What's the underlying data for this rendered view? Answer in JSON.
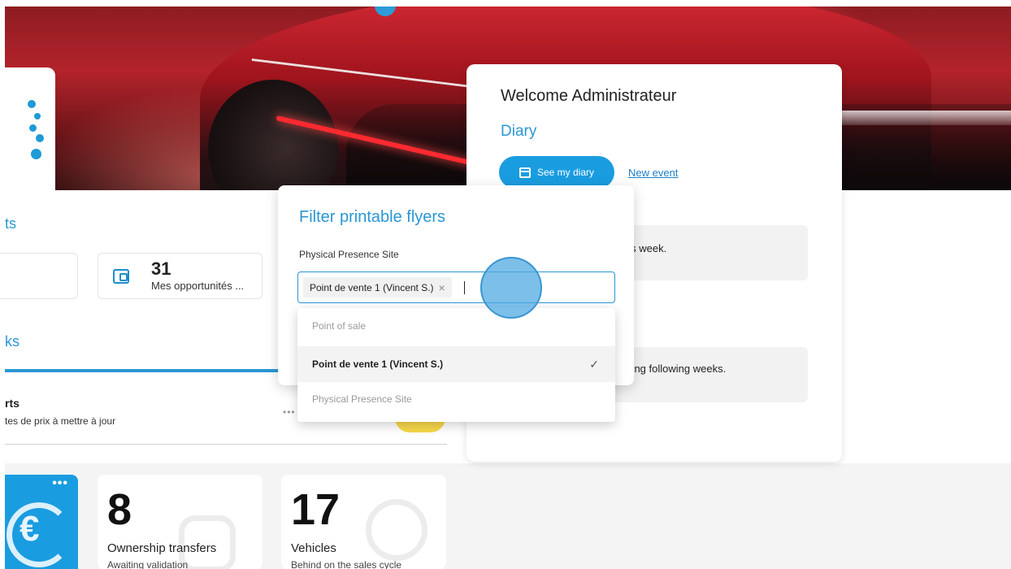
{
  "left_panel": {
    "section_title_partial": "ts",
    "tasks_title_partial": "ks",
    "opportunities": {
      "count": "31",
      "label": "Mes opportunités ..."
    }
  },
  "alerts": {
    "title_partial": "rts",
    "subtitle_partial": "tes de prix à mettre à jour",
    "more": "•••"
  },
  "kpis": [
    {
      "more": "•••",
      "icon": "euro-refresh-icon"
    },
    {
      "value": "8",
      "label": "Ownership transfers",
      "sub": "Awaiting validation",
      "icon": "car-ghost-icon"
    },
    {
      "value": "17",
      "label": "Vehicles",
      "sub": "Behind on the sales cycle",
      "icon": "stopwatch-ghost-icon"
    }
  ],
  "welcome": {
    "title": "Welcome Administrateur",
    "diary_title": "Diary",
    "see_diary_label": "See my diary",
    "new_event_label": "New event",
    "this_week_text": "his week.",
    "following_weeks_text": "uring following weeks."
  },
  "filter": {
    "title": "Filter printable flyers",
    "field_label": "Physical Presence Site",
    "selected_chip": "Point de vente 1 (Vincent S.)",
    "chip_remove": "×",
    "options": [
      {
        "label": "Point of sale",
        "type": "group"
      },
      {
        "label": "Point de vente 1 (Vincent S.)",
        "type": "option",
        "selected": true,
        "check": "✓"
      },
      {
        "label": "Physical Presence Site",
        "type": "group"
      }
    ]
  },
  "colors": {
    "accent": "#2a97d4",
    "primary_button": "#1a9ce0",
    "yellow_badge": "#f7d84a"
  }
}
